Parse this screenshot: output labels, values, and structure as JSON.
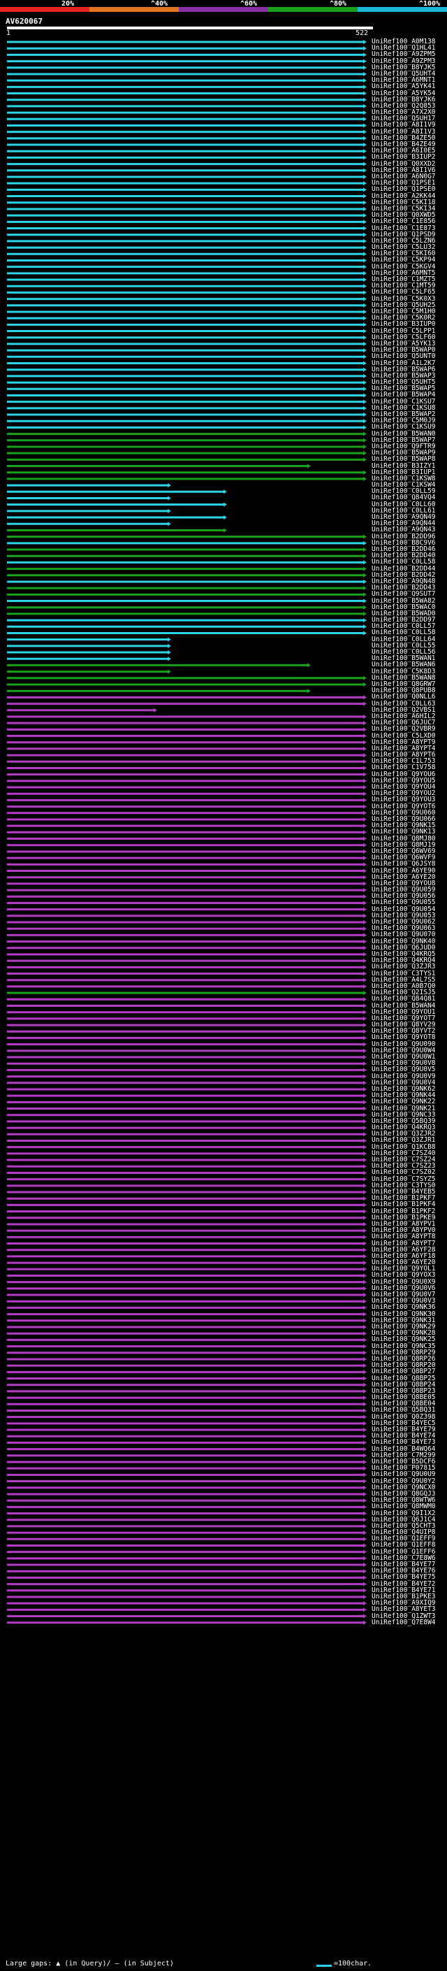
{
  "identity_scale": [
    {
      "label": "20%",
      "color": "#e8231f"
    },
    {
      "label": "^40%",
      "color": "#e37722"
    },
    {
      "label": "^60%",
      "color": "#8b2fa6"
    },
    {
      "label": "^80%",
      "color": "#1aa11a"
    },
    {
      "label": "^100%",
      "color": "#1fb7d9"
    }
  ],
  "query": {
    "name": "AV620067",
    "start": "1",
    "end": "522"
  },
  "legend": {
    "large_gaps": "Large gaps:",
    "in_query": "(in Query)/",
    "in_subject": "(in Subject)",
    "scale": "=100char."
  },
  "hits": [
    "UniRef100_A0M138",
    "UniRef100_Q1HL41",
    "UniRef100_A9ZPM5",
    "UniRef100_A9ZPM3",
    "UniRef100_B8YJK5",
    "UniRef100_Q5UHT4",
    "UniRef100_A6MNT1",
    "UniRef100_A5YK41",
    "UniRef100_A5YK54",
    "UniRef100_B8YJK6",
    "UniRef100_Q2Q853",
    "UniRef100_A7X2X0",
    "UniRef100_Q5UH17",
    "UniRef100_A8I1V9",
    "UniRef100_A8I1V3",
    "UniRef100_B4ZE50",
    "UniRef100_B4ZE49",
    "UniRef100_A6I0E5",
    "UniRef100_B3IUP2",
    "UniRef100_Q0XXD2",
    "UniRef100_A8I1V6",
    "UniRef100_A6N0G7",
    "UniRef100_Q1PSE1",
    "UniRef100_Q1PSE0",
    "UniRef100_A2KK44",
    "UniRef100_C5KI18",
    "UniRef100_C5KI34",
    "UniRef100_Q0XWD5",
    "UniRef100_C1E856",
    "UniRef100_C1E873",
    "UniRef100_Q1PSD9",
    "UniRef100_C5LZN6",
    "UniRef100_C5LU32",
    "UniRef100_C5KI60",
    "UniRef100_C5KP94",
    "UniRef100_C5KGV4",
    "UniRef100_A6MNT5",
    "UniRef100_C1MZT5",
    "UniRef100_C1MT59",
    "UniRef100_C5LF65",
    "UniRef100_C5K0X3",
    "UniRef100_Q5UH25",
    "UniRef100_C5M1H0",
    "UniRef100_C5K0R2",
    "UniRef100_B3IUP0",
    "UniRef100_C5LPP1",
    "UniRef100_C5LF60",
    "UniRef100_A5YK13",
    "UniRef100_B5WAP0",
    "UniRef100_Q5UNT0",
    "UniRef100_A1L2K7",
    "UniRef100_B5WAP6",
    "UniRef100_B5WAP3",
    "UniRef100_Q5UHT5",
    "UniRef100_B5WAP5",
    "UniRef100_B5WAP4",
    "UniRef100_C1KSU7",
    "UniRef100_C1KSU8",
    "UniRef100_B5WAP2",
    "UniRef100_C5M0J9",
    "UniRef100_C1KSU9",
    "UniRef100_B5WAN0",
    "UniRef100_B5WAP7",
    "UniRef100_Q9FTR9",
    "UniRef100_B5WAP9",
    "UniRef100_B5WAP8",
    "UniRef100_B3IZY1",
    "UniRef100_B3IUP1",
    "UniRef100_C1KSW8",
    "UniRef100_C1KSW4",
    "UniRef100_C0LL59",
    "UniRef100_Q84VQ4",
    "UniRef100_C0LL60",
    "UniRef100_C0LL61",
    "UniRef100_A9QN49",
    "UniRef100_A9QN44",
    "UniRef100_A9QN43",
    "UniRef100_B2DD96",
    "UniRef100_B8C9V6",
    "UniRef100_B2DD46",
    "UniRef100_B2DD40",
    "UniRef100_C0LL58",
    "UniRef100_B2DD44",
    "UniRef100_B2DD42",
    "UniRef100_A9QN48",
    "UniRef100_B2DD43",
    "UniRef100_Q9SUT7",
    "UniRef100_B5WA82",
    "UniRef100_B5WAC0",
    "UniRef100_B5WAD0",
    "UniRef100_B2DD97",
    "UniRef100_C0LL57",
    "UniRef100_C0LL58",
    "UniRef100_C0LL64",
    "UniRef100_C0LL55",
    "UniRef100_C0LL56",
    "UniRef100_B5WAN1",
    "UniRef100_B5WAN6",
    "UniRef100_C5K8D3",
    "UniRef100_B5WAN8",
    "UniRef100_Q8GRW7",
    "UniRef100_Q8PUB8",
    "UniRef100_Q0NLL6",
    "UniRef100_C0LL63",
    "UniRef100_Q2VBS1",
    "UniRef100_A6HIL2",
    "UniRef100_Q6JUC7",
    "UniRef100_Q2VBR9",
    "UniRef100_C5LXD0",
    "UniRef100_A8YPT9",
    "UniRef100_A8YPT4",
    "UniRef100_A8YPT6",
    "UniRef100_C1L753",
    "UniRef100_C1V758",
    "UniRef100_Q9YOU6",
    "UniRef100_Q9YOU5",
    "UniRef100_Q9YOU4",
    "UniRef100_Q9YOU2",
    "UniRef100_Q9YOU3",
    "UniRef100_Q9YOT6",
    "UniRef100_Q9U060",
    "UniRef100_Q9U066",
    "UniRef100_Q9NK15",
    "UniRef100_Q9NK13",
    "UniRef100_Q8MJ80",
    "UniRef100_Q8MJ19",
    "UniRef100_Q6WV69",
    "UniRef100_Q6WVF9",
    "UniRef100_Q6JSY8",
    "UniRef100_A6YE90",
    "UniRef100_A6YE20",
    "UniRef100_Q9YOU8",
    "UniRef100_Q9U059",
    "UniRef100_Q9U056",
    "UniRef100_Q9U055",
    "UniRef100_Q9U054",
    "UniRef100_Q9U053",
    "UniRef100_Q9U062",
    "UniRef100_Q9U063",
    "UniRef100_Q9U070",
    "UniRef100_Q9NK40",
    "UniRef100_Q6JUD0",
    "UniRef100_Q4KRQ5",
    "UniRef100_Q4KRQ4",
    "UniRef100_Q3ZJR3",
    "UniRef100_C3TYS1",
    "UniRef100_A4L7S5",
    "UniRef100_A0B7Q0",
    "UniRef100_Q2ISJ5",
    "UniRef100_Q84Q81",
    "UniRef100_B5WAN4",
    "UniRef100_Q9YOU1",
    "UniRef100_Q9YOT7",
    "UniRef100_Q8YV29",
    "UniRef100_Q8YVT2",
    "UniRef100_Q9YOT8",
    "UniRef100_Q9U090",
    "UniRef100_Q9U0W4",
    "UniRef100_Q9U0W1",
    "UniRef100_Q9U0V8",
    "UniRef100_Q9U0V5",
    "UniRef100_Q9U0V9",
    "UniRef100_Q9U0V4",
    "UniRef100_Q9NK62",
    "UniRef100_Q9NK44",
    "UniRef100_Q9NK22",
    "UniRef100_Q9NK21",
    "UniRef100_Q9NC33",
    "UniRef100_Q5BQ39",
    "UniRef100_Q4KRQ3",
    "UniRef100_Q3ZJR2",
    "UniRef100_Q3ZJR1",
    "UniRef100_Q1KCB8",
    "UniRef100_C7SZ40",
    "UniRef100_C7SZ24",
    "UniRef100_C7SZ23",
    "UniRef100_C7SZ02",
    "UniRef100_C7SYZ5",
    "UniRef100_C3TYS0",
    "UniRef100_B4YEB5",
    "UniRef100_B1PKF7",
    "UniRef100_B1PKF4",
    "UniRef100_B1PKF2",
    "UniRef100_B1PKE9",
    "UniRef100_A8YPV1",
    "UniRef100_A8YPV0",
    "UniRef100_A8YPT8",
    "UniRef100_A8YPT7",
    "UniRef100_A6YF28",
    "UniRef100_A6YF18",
    "UniRef100_A6YE20",
    "UniRef100_Q9YOL1",
    "UniRef100_Q9YOX3",
    "UniRef100_Q9U0X9",
    "UniRef100_Q9U0V6",
    "UniRef100_Q9U0V7",
    "UniRef100_Q9U0V3",
    "UniRef100_Q9NK36",
    "UniRef100_Q9NK30",
    "UniRef100_Q9NK31",
    "UniRef100_Q9NK29",
    "UniRef100_Q9NK28",
    "UniRef100_Q9NK25",
    "UniRef100_Q9NC35",
    "UniRef100_Q8RP29",
    "UniRef100_Q8RP26",
    "UniRef100_Q8RP20",
    "UniRef100_Q8BP27",
    "UniRef100_Q8BP25",
    "UniRef100_Q8BP24",
    "UniRef100_Q8BP23",
    "UniRef100_Q8BE05",
    "UniRef100_Q8BE04",
    "UniRef100_Q5BQ31",
    "UniRef100_Q0Z398",
    "UniRef100_B4YEC5",
    "UniRef100_B4YE79",
    "UniRef100_B4YE74",
    "UniRef100_B4YE73",
    "UniRef100_B4WQ64",
    "UniRef100_C7M299",
    "UniRef100_B5DCF6",
    "UniRef100_P07815",
    "UniRef100_Q9U0U9",
    "UniRef100_Q9U0Y2",
    "UniRef100_Q9NCX0",
    "UniRef100_Q8GQJ3",
    "UniRef100_Q8WTW6",
    "UniRef100_Q8MWM0",
    "UniRef100_Q9I1X2",
    "UniRef100_Q6J1C4",
    "UniRef100_Q5CHT3",
    "UniRef100_Q4UIP8",
    "UniRef100_Q1EFF9",
    "UniRef100_Q1EFF8",
    "UniRef100_Q1EFF6",
    "UniRef100_C7E8W6",
    "UniRef100_B4YE77",
    "UniRef100_B4YE76",
    "UniRef100_B4YE75",
    "UniRef100_B4YE72",
    "UniRef100_B4YE71",
    "UniRef100_B1PKE3",
    "UniRef100_A9XIQ9",
    "UniRef100_A8YET3",
    "UniRef100_Q1ZWT3",
    "UniRef100_Q7E8W4"
  ]
}
